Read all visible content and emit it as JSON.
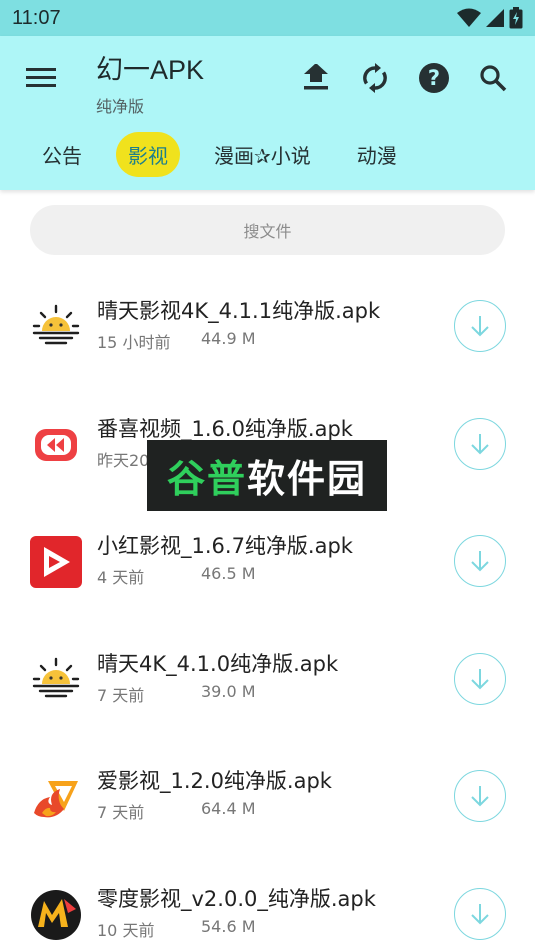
{
  "status_bar": {
    "time": "11:07"
  },
  "app_bar": {
    "title": "幻一APK",
    "subtitle": "纯净版",
    "actions": [
      "upload-icon",
      "sync-icon",
      "help-icon",
      "search-icon"
    ]
  },
  "tabs": [
    {
      "label": "公告",
      "active": false
    },
    {
      "label": "影视",
      "active": true
    },
    {
      "label": "漫画✰小说",
      "active": false
    },
    {
      "label": "动漫",
      "active": false
    }
  ],
  "search": {
    "placeholder": "搜文件"
  },
  "files": [
    {
      "name": "晴天影视4K_4.1.1纯净版.apk",
      "age": "15 小时前",
      "size": "44.9 M",
      "icon": "sun-icon"
    },
    {
      "name": "番喜视频_1.6.0纯净版.apk",
      "age": "昨天20",
      "size": "",
      "icon": "rewind-icon"
    },
    {
      "name": "小红影视_1.6.7纯净版.apk",
      "age": "4 天前",
      "size": "46.5 M",
      "icon": "play-icon"
    },
    {
      "name": "晴天4K_4.1.0纯净版.apk",
      "age": "7 天前",
      "size": "39.0 M",
      "icon": "sun-icon"
    },
    {
      "name": "爱影视_1.2.0纯净版.apk",
      "age": "7 天前",
      "size": "64.4 M",
      "icon": "flame-icon"
    },
    {
      "name": "零度影视_v2.0.0_纯净版.apk",
      "age": "10 天前",
      "size": "54.6 M",
      "icon": "m-logo-icon"
    }
  ],
  "watermark": {
    "green": "谷普",
    "white": "软件园"
  },
  "colors": {
    "status_bar": "#7edfe1",
    "app_bar": "#aef6f7",
    "active_tab": "#f0e21d",
    "accent": "#7dd7df"
  }
}
